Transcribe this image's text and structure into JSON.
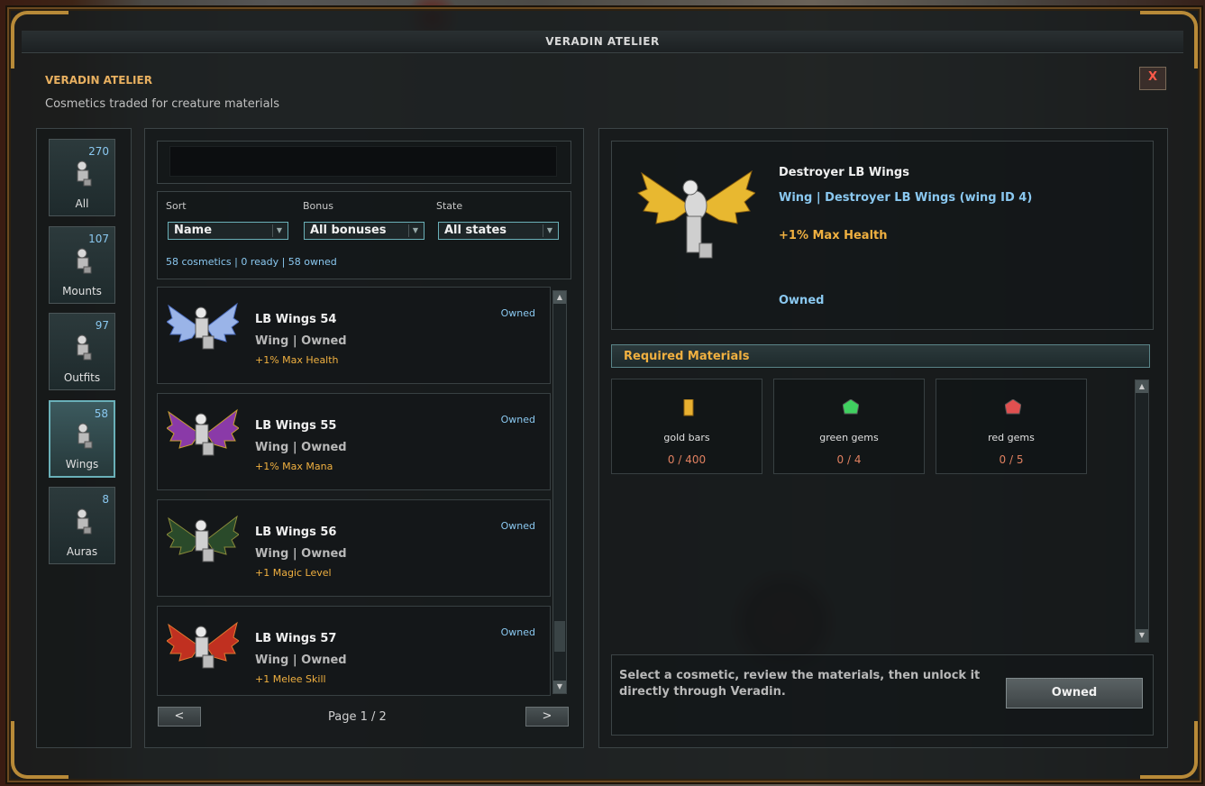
{
  "window": {
    "title": "VERADIN ATELIER",
    "close_label": "X"
  },
  "header": {
    "title": "VERADIN ATELIER",
    "subtitle": "Cosmetics traded for creature materials"
  },
  "categories": [
    {
      "label": "All",
      "count": "270",
      "selected": false
    },
    {
      "label": "Mounts",
      "count": "107",
      "selected": false
    },
    {
      "label": "Outfits",
      "count": "97",
      "selected": false
    },
    {
      "label": "Wings",
      "count": "58",
      "selected": true
    },
    {
      "label": "Auras",
      "count": "8",
      "selected": false
    }
  ],
  "search": {
    "value": "",
    "placeholder": ""
  },
  "filters": {
    "sort": {
      "label": "Sort",
      "value": "Name"
    },
    "bonus": {
      "label": "Bonus",
      "value": "All bonuses"
    },
    "state": {
      "label": "State",
      "value": "All states"
    }
  },
  "summary": "58 cosmetics | 0 ready | 58 owned",
  "items": [
    {
      "name": "LB Wings 54",
      "type": "Wing | Owned",
      "bonus": "+1% Max Health",
      "state": "Owned",
      "colors": [
        "#9ab4e8",
        "#4a6ab8"
      ]
    },
    {
      "name": "LB Wings 55",
      "type": "Wing | Owned",
      "bonus": "+1% Max Mana",
      "state": "Owned",
      "colors": [
        "#8a3aa8",
        "#c8a030"
      ]
    },
    {
      "name": "LB Wings 56",
      "type": "Wing | Owned",
      "bonus": "+1 Magic Level",
      "state": "Owned",
      "colors": [
        "#2a4a2a",
        "#8a8a3a"
      ]
    },
    {
      "name": "LB Wings 57",
      "type": "Wing | Owned",
      "bonus": "+1 Melee Skill",
      "state": "Owned",
      "colors": [
        "#c03020",
        "#e07830"
      ]
    }
  ],
  "pagination": {
    "prev_label": "<",
    "next_label": ">",
    "page_text": "Page  1  /  2"
  },
  "detail": {
    "name": "Destroyer LB Wings",
    "type": "Wing  |  Destroyer LB Wings (wing ID 4)",
    "bonus": "+1% Max Health",
    "state": "Owned"
  },
  "materials": {
    "header": "Required Materials",
    "list": [
      {
        "name": "gold bars",
        "value": "0 / 400",
        "icon": "gold-bar-icon",
        "color": "#e8b030"
      },
      {
        "name": "green gems",
        "value": "0 / 4",
        "icon": "green-gem-icon",
        "color": "#40d060"
      },
      {
        "name": "red gems",
        "value": "0 / 5",
        "icon": "red-gem-icon",
        "color": "#e05050"
      }
    ]
  },
  "hint": "Select a cosmetic, review the materials, then unlock it directly through Veradin.",
  "action_button": "Owned"
}
